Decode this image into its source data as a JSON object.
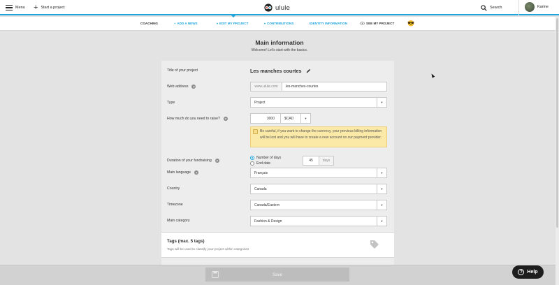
{
  "topbar": {
    "menu_label": "Menu",
    "start_label": "Start a project",
    "logo_text": "ulule",
    "search_label": "Search",
    "user_name": "Karine"
  },
  "subnav": {
    "items": [
      {
        "label": "COACHING",
        "style": "dark"
      },
      {
        "label": "ADD A NEWS",
        "style": "blue",
        "icon": "plus-icon"
      },
      {
        "label": "EDIT MY PROJECT",
        "style": "blue",
        "icon": "chevron-down-icon"
      },
      {
        "label": "CONTRIBUTIONS",
        "style": "blue",
        "icon": "chevron-down-icon"
      },
      {
        "label": "IDENTITY INFORMATION",
        "style": "blue"
      },
      {
        "label": "SEE MY PROJECT",
        "style": "dark",
        "icon": "eye-icon"
      }
    ],
    "emoji": "😎",
    "accent_color": "#1ea5dc"
  },
  "main": {
    "title": "Main information",
    "subtitle": "Welcome! Let's start with the basics."
  },
  "form": {
    "title_label": "Title of your project",
    "title_value": "Les manches courtes",
    "web_label": "Web address",
    "web_prefix": "www.ulule.com",
    "web_value": "les-manches-courtes",
    "type_label": "Type",
    "type_value": "Project",
    "raise_label": "How much do you need to raise?",
    "raise_value": "3000",
    "currency_value": "$CAD",
    "warning_text": "Be careful, if you want to change the currency, your previous billing information will be lost and you will have to create a new account on our payment provider.",
    "duration_label": "Duration of your fundraising",
    "duration_option_days": "Number of days",
    "duration_option_end": "End date",
    "days_value": "45",
    "days_unit": "days",
    "language_label": "Main language",
    "language_value": "Français",
    "country_label": "Country",
    "country_value": "Canada",
    "timezone_label": "Timezone",
    "timezone_value": "Canada/Eastern",
    "category_label": "Main category",
    "category_value": "Fashion & Design"
  },
  "tags": {
    "title": "Tags (max. 5 tags)",
    "subtitle": "Tags will be used to classify your project within categories"
  },
  "footer": {
    "save_label": "Save",
    "help_label": "Help"
  }
}
